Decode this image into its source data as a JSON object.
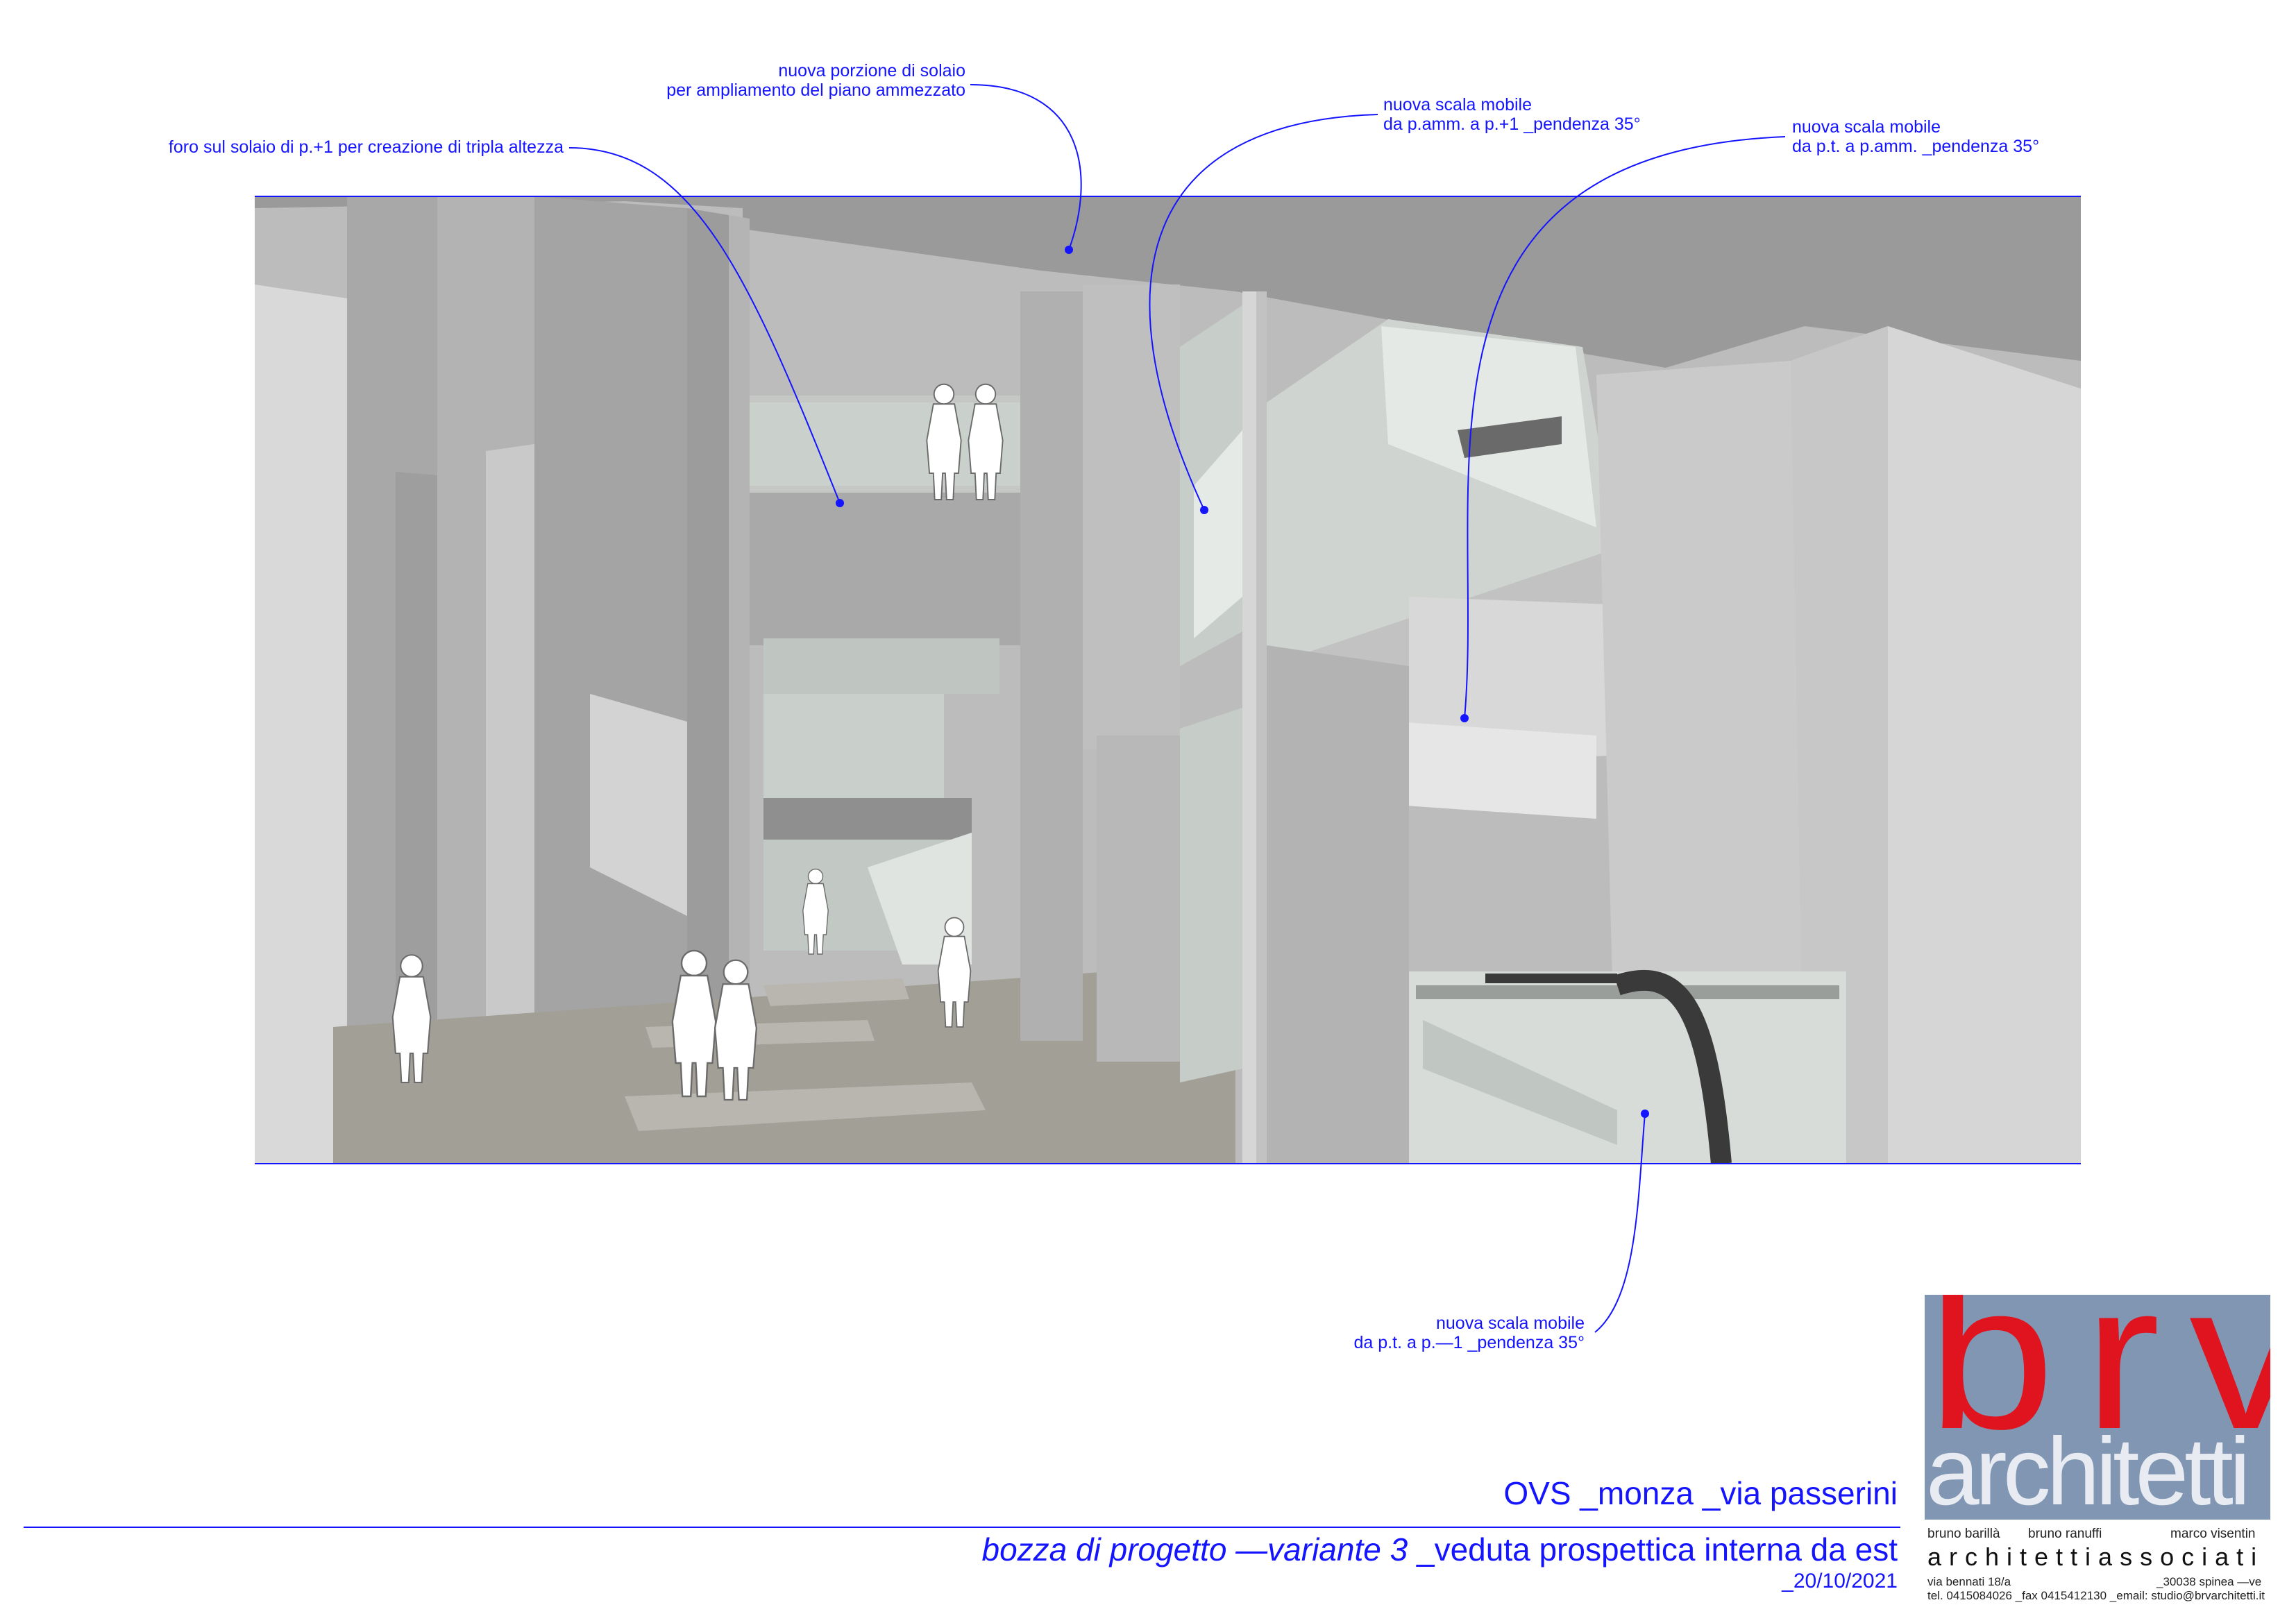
{
  "annotations": [
    {
      "id": "solaio",
      "lines": [
        "nuova porzione di solaio",
        "per ampliamento del piano ammezzato"
      ]
    },
    {
      "id": "foro",
      "lines": [
        "foro sul solaio di p.+1 per creazione di tripla altezza"
      ]
    },
    {
      "id": "scala-amm",
      "lines": [
        "nuova scala mobile",
        "da p.amm. a p.+1 _pendenza 35°"
      ]
    },
    {
      "id": "scala-pt",
      "lines": [
        "nuova scala mobile",
        "da p.t. a p.amm. _pendenza 35°"
      ]
    },
    {
      "id": "scala-meno1",
      "lines": [
        "nuova scala mobile",
        "da p.t. a p.—1 _pendenza 35°"
      ]
    }
  ],
  "title_block": {
    "project": "OVS _monza _via passerini",
    "subtitle_italic": "bozza di progetto —variante 3",
    "subtitle_rest": " _veduta prospettica interna da est",
    "date": "_20/10/2021"
  },
  "logo": {
    "brand": "brv",
    "word": "architetti",
    "partners": [
      "bruno barillà",
      "bruno ranuffi",
      "marco visentin"
    ],
    "firm": "architettiassociati",
    "address_left": "via bennati 18/a",
    "address_right": "_30038 spinea —ve",
    "contacts": "tel. 0415084026 _fax 0415412130 _email: studio@brvarchitetti.it"
  },
  "colors": {
    "annotation": "#1414ff",
    "logo_bg": "#8096b2",
    "logo_red": "#e0141e"
  }
}
